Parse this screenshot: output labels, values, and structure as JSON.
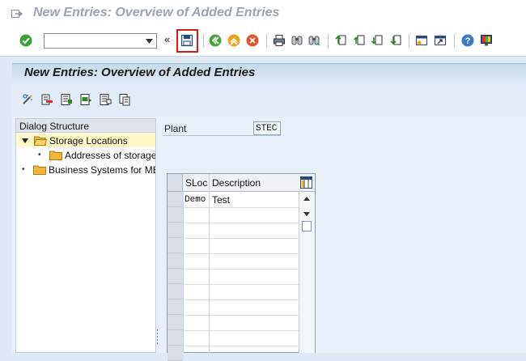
{
  "window": {
    "title": "New Entries: Overview of Added Entries"
  },
  "toolbar": {
    "command_value": "",
    "toggle_label": "«"
  },
  "screen": {
    "title": "New Entries: Overview of Added Entries"
  },
  "dialog_structure": {
    "header": "Dialog Structure",
    "items": [
      {
        "label": "Storage Locations",
        "level": 0,
        "expanded": true,
        "selected": true
      },
      {
        "label": "Addresses of storage",
        "level": 1,
        "expanded": false,
        "selected": false
      },
      {
        "label": "Business Systems for ME",
        "level": 0,
        "expanded": false,
        "selected": false
      }
    ]
  },
  "plant": {
    "label": "Plant",
    "value": "STEC"
  },
  "table": {
    "columns": [
      "SLoc",
      "Description"
    ],
    "rows": [
      {
        "sloc": "Demo",
        "description": "Test"
      }
    ]
  },
  "colors": {
    "highlight_box": "#d91b1b",
    "selected_row": "#fff8c8",
    "header_bg": "#c7d9ee"
  },
  "icons": {
    "toolbar": [
      "enter-check-icon",
      "save-icon",
      "back-icon",
      "exit-icon",
      "cancel-icon",
      "print-icon",
      "find-icon",
      "find-next-icon",
      "first-page-icon",
      "previous-page-icon",
      "next-page-icon",
      "last-page-icon",
      "create-session-icon",
      "shortcut-icon",
      "help-icon",
      "customize-layout-icon"
    ],
    "application": [
      "display-change-icon",
      "delete-row-icon",
      "select-all-icon",
      "select-block-icon",
      "deselect-all-icon",
      "copy-as-icon"
    ]
  }
}
